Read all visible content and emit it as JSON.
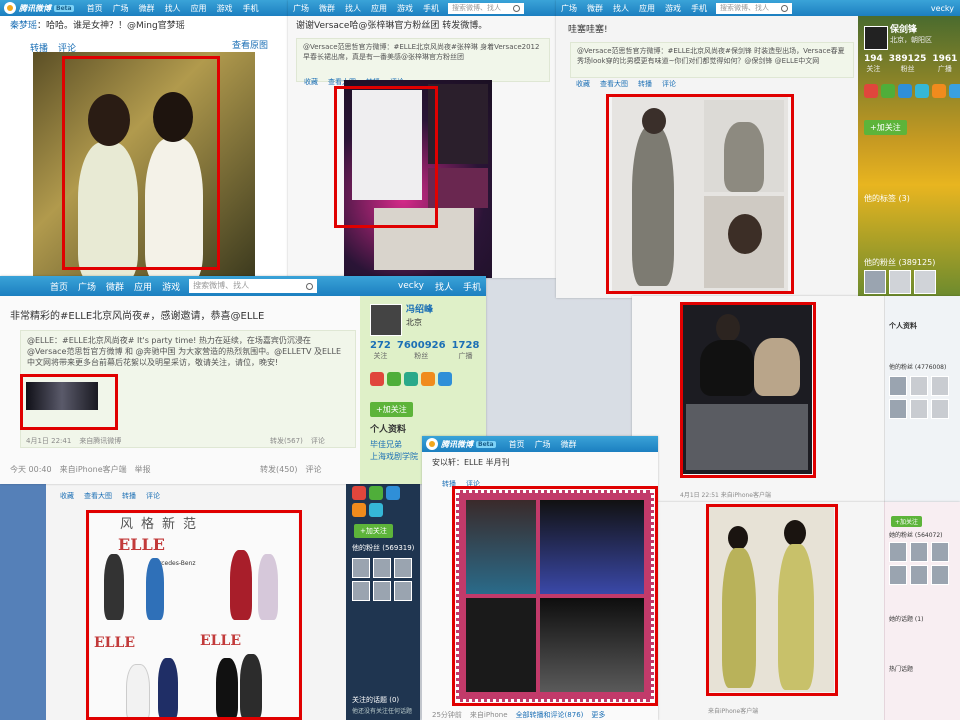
{
  "nav": {
    "brand": "腾讯微博",
    "beta": "Beta",
    "home": "首页",
    "plaza": "广场",
    "weibo": "微群",
    "people": "找人",
    "apps": "应用",
    "games": "游戏",
    "phone": "手机",
    "search_placeholder": "搜索微博、找人",
    "user": "vecky"
  },
  "p1": {
    "header": "秦梦瑶",
    "text": "哈哈。谁是女神？！@Ming官梦瑶",
    "action_repost": "转播",
    "action_comment": "评论",
    "action_view": "查看原图"
  },
  "p2": {
    "text": "谢谢Versace哈@张梓琳官方粉丝团 转发微博。",
    "repost_text": "@Versace范思哲官方微博：#ELLE北京风尚夜#张梓琳 身着Versace2012早春长裙出席，真是有一番美感@张梓琳官方粉丝团",
    "action_collect": "收藏",
    "action_view": "查看大图",
    "action_repost": "转播",
    "action_comment": "评论"
  },
  "p3": {
    "text": "哇塞哇塞!",
    "repost_text": "@Versace范思哲官方微博：#ELLE北京风尚夜#保剑锋 时装造型出场，Versace春夏秀场look穿的比男模更有味道~你们对们都觉得如何？@保剑锋 @ELLE中文网",
    "action_collect": "收藏",
    "action_view": "查看大图",
    "action_repost": "转播",
    "action_comment": "评论",
    "profile_name": "保剑锋",
    "profile_loc": "北京，朝阳区",
    "stats": [
      {
        "num": "194",
        "label": "关注"
      },
      {
        "num": "389125",
        "label": "粉丝"
      },
      {
        "num": "1961",
        "label": "广播"
      }
    ],
    "follow": "+加关注",
    "tags_title": "他的标签 (3)",
    "fans_title": "他的粉丝 (389125)"
  },
  "p4": {
    "text": "非常精彩的#ELLE北京风尚夜#，感谢邀请，恭喜@ELLE",
    "repost_text": "@ELLE：#ELLE北京风尚夜# It's party time! 热力在延续，在场嘉宾仍沉浸在@Versace范思哲官方微博 和 @奔驰中国 为大家营造的热烈氛围中。@ELLETV 及ELLE中文网将带来更多台前幕后花絮以及明星采访，敬请关注，请位，晚安!",
    "repost_meta_date": "4月1日 22:41",
    "repost_meta_from": "来自腾讯微博",
    "repost_count": "转发(567)",
    "repost_comment": "评论",
    "meta_time": "今天 00:40",
    "meta_from": "来自iPhone客户端",
    "meta_report": "举报",
    "meta_repost": "转发(450)",
    "meta_comment": "评论",
    "profile_name": "冯绍峰",
    "profile_loc": "北京",
    "stats": [
      {
        "num": "272",
        "label": "关注"
      },
      {
        "num": "7600926",
        "label": "粉丝"
      },
      {
        "num": "1728",
        "label": "广播"
      }
    ],
    "follow": "+加关注",
    "info_title": "个人资料",
    "info_line1": "毕佳兄弟",
    "info_line2": "上海戏剧学院"
  },
  "p5": {
    "info_title": "个人资料",
    "fans_title": "他的粉丝 (4776008)",
    "meta": "4月1日 22:51 来自iPhone客户端",
    "follow": "+加关注",
    "fans2_title": "她的粉丝 (564072)",
    "topics_title": "她的话题 (1)",
    "hot_title": "热门话题"
  },
  "p6": {
    "action_collect": "收藏",
    "action_view": "查看大图",
    "action_repost": "转播",
    "action_comment": "评论",
    "elle": "ELLE",
    "banner1": "风格新范",
    "mb": "Mercedes-Benz",
    "follow": "+加关注",
    "fans_title": "他的粉丝 (569319)",
    "topics_title": "关注的话题 (0)",
    "topics_sub": "他还没有关注任何话题"
  },
  "p7": {
    "text": "安以轩：ELLE 半月刊",
    "action_repost": "转播",
    "action_comment": "评论",
    "meta_time": "25分钟前",
    "meta_from": "来自iPhone",
    "meta_comment": "全部转播和评论(876)",
    "meta_more": "更多"
  },
  "p8": {
    "meta": "来自iPhone客户端",
    "topics_title": "热门话题"
  }
}
